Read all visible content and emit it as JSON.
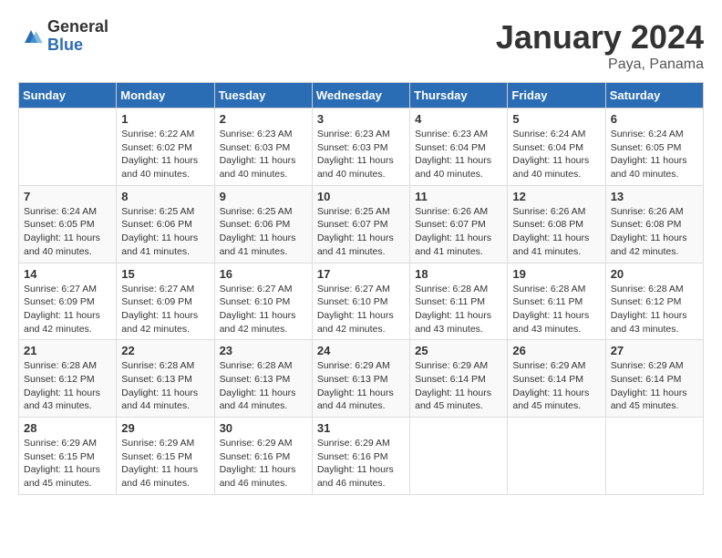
{
  "header": {
    "logo_general": "General",
    "logo_blue": "Blue",
    "title": "January 2024",
    "location": "Paya, Panama"
  },
  "days_of_week": [
    "Sunday",
    "Monday",
    "Tuesday",
    "Wednesday",
    "Thursday",
    "Friday",
    "Saturday"
  ],
  "weeks": [
    [
      {
        "day": "",
        "info": ""
      },
      {
        "day": "1",
        "info": "Sunrise: 6:22 AM\nSunset: 6:02 PM\nDaylight: 11 hours and 40 minutes."
      },
      {
        "day": "2",
        "info": "Sunrise: 6:23 AM\nSunset: 6:03 PM\nDaylight: 11 hours and 40 minutes."
      },
      {
        "day": "3",
        "info": "Sunrise: 6:23 AM\nSunset: 6:03 PM\nDaylight: 11 hours and 40 minutes."
      },
      {
        "day": "4",
        "info": "Sunrise: 6:23 AM\nSunset: 6:04 PM\nDaylight: 11 hours and 40 minutes."
      },
      {
        "day": "5",
        "info": "Sunrise: 6:24 AM\nSunset: 6:04 PM\nDaylight: 11 hours and 40 minutes."
      },
      {
        "day": "6",
        "info": "Sunrise: 6:24 AM\nSunset: 6:05 PM\nDaylight: 11 hours and 40 minutes."
      }
    ],
    [
      {
        "day": "7",
        "info": "Sunrise: 6:24 AM\nSunset: 6:05 PM\nDaylight: 11 hours and 40 minutes."
      },
      {
        "day": "8",
        "info": "Sunrise: 6:25 AM\nSunset: 6:06 PM\nDaylight: 11 hours and 41 minutes."
      },
      {
        "day": "9",
        "info": "Sunrise: 6:25 AM\nSunset: 6:06 PM\nDaylight: 11 hours and 41 minutes."
      },
      {
        "day": "10",
        "info": "Sunrise: 6:25 AM\nSunset: 6:07 PM\nDaylight: 11 hours and 41 minutes."
      },
      {
        "day": "11",
        "info": "Sunrise: 6:26 AM\nSunset: 6:07 PM\nDaylight: 11 hours and 41 minutes."
      },
      {
        "day": "12",
        "info": "Sunrise: 6:26 AM\nSunset: 6:08 PM\nDaylight: 11 hours and 41 minutes."
      },
      {
        "day": "13",
        "info": "Sunrise: 6:26 AM\nSunset: 6:08 PM\nDaylight: 11 hours and 42 minutes."
      }
    ],
    [
      {
        "day": "14",
        "info": "Sunrise: 6:27 AM\nSunset: 6:09 PM\nDaylight: 11 hours and 42 minutes."
      },
      {
        "day": "15",
        "info": "Sunrise: 6:27 AM\nSunset: 6:09 PM\nDaylight: 11 hours and 42 minutes."
      },
      {
        "day": "16",
        "info": "Sunrise: 6:27 AM\nSunset: 6:10 PM\nDaylight: 11 hours and 42 minutes."
      },
      {
        "day": "17",
        "info": "Sunrise: 6:27 AM\nSunset: 6:10 PM\nDaylight: 11 hours and 42 minutes."
      },
      {
        "day": "18",
        "info": "Sunrise: 6:28 AM\nSunset: 6:11 PM\nDaylight: 11 hours and 43 minutes."
      },
      {
        "day": "19",
        "info": "Sunrise: 6:28 AM\nSunset: 6:11 PM\nDaylight: 11 hours and 43 minutes."
      },
      {
        "day": "20",
        "info": "Sunrise: 6:28 AM\nSunset: 6:12 PM\nDaylight: 11 hours and 43 minutes."
      }
    ],
    [
      {
        "day": "21",
        "info": "Sunrise: 6:28 AM\nSunset: 6:12 PM\nDaylight: 11 hours and 43 minutes."
      },
      {
        "day": "22",
        "info": "Sunrise: 6:28 AM\nSunset: 6:13 PM\nDaylight: 11 hours and 44 minutes."
      },
      {
        "day": "23",
        "info": "Sunrise: 6:28 AM\nSunset: 6:13 PM\nDaylight: 11 hours and 44 minutes."
      },
      {
        "day": "24",
        "info": "Sunrise: 6:29 AM\nSunset: 6:13 PM\nDaylight: 11 hours and 44 minutes."
      },
      {
        "day": "25",
        "info": "Sunrise: 6:29 AM\nSunset: 6:14 PM\nDaylight: 11 hours and 45 minutes."
      },
      {
        "day": "26",
        "info": "Sunrise: 6:29 AM\nSunset: 6:14 PM\nDaylight: 11 hours and 45 minutes."
      },
      {
        "day": "27",
        "info": "Sunrise: 6:29 AM\nSunset: 6:14 PM\nDaylight: 11 hours and 45 minutes."
      }
    ],
    [
      {
        "day": "28",
        "info": "Sunrise: 6:29 AM\nSunset: 6:15 PM\nDaylight: 11 hours and 45 minutes."
      },
      {
        "day": "29",
        "info": "Sunrise: 6:29 AM\nSunset: 6:15 PM\nDaylight: 11 hours and 46 minutes."
      },
      {
        "day": "30",
        "info": "Sunrise: 6:29 AM\nSunset: 6:16 PM\nDaylight: 11 hours and 46 minutes."
      },
      {
        "day": "31",
        "info": "Sunrise: 6:29 AM\nSunset: 6:16 PM\nDaylight: 11 hours and 46 minutes."
      },
      {
        "day": "",
        "info": ""
      },
      {
        "day": "",
        "info": ""
      },
      {
        "day": "",
        "info": ""
      }
    ]
  ]
}
